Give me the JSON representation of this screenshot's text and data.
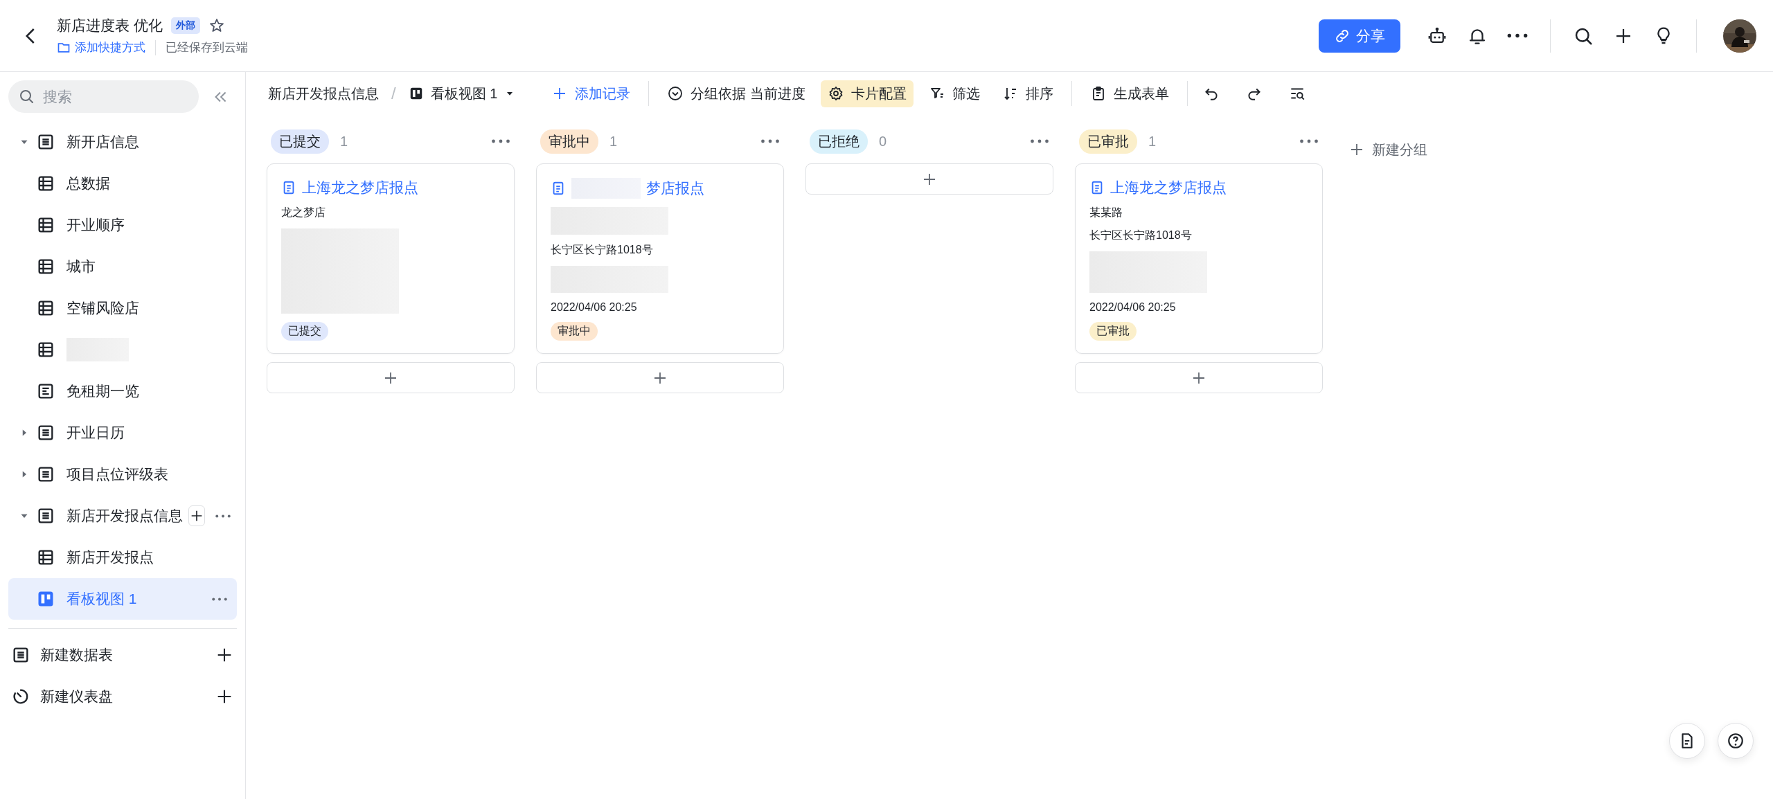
{
  "header": {
    "title": "新店进度表 优化",
    "badge": "外部",
    "starred": false,
    "shortcut": "添加快捷方式",
    "save_status": "已经保存到云端",
    "share": "分享"
  },
  "sidebar": {
    "search": {
      "placeholder": "搜索"
    },
    "tree": [
      {
        "label": "新开店信息",
        "kind": "group",
        "expanded": true,
        "selected": false,
        "children": [
          {
            "label": "总数据",
            "kind": "table",
            "selected": false
          },
          {
            "label": "开业顺序",
            "kind": "table",
            "selected": false
          },
          {
            "label": "城市",
            "kind": "table",
            "selected": false
          },
          {
            "label": "空铺风险店",
            "kind": "table",
            "selected": false
          },
          {
            "kind": "table",
            "redacted": true,
            "selected": false
          },
          {
            "label": "免租期一览",
            "kind": "form",
            "selected": false
          }
        ]
      },
      {
        "label": "开业日历",
        "kind": "group",
        "expanded": false,
        "selected": false
      },
      {
        "label": "项目点位评级表",
        "kind": "group",
        "expanded": false,
        "selected": false
      },
      {
        "label": "新店开发报点信息",
        "kind": "group",
        "expanded": true,
        "selected": false,
        "actions": true,
        "children": [
          {
            "label": "新店开发报点",
            "kind": "table",
            "selected": false
          },
          {
            "label": "看板视图 1",
            "kind": "kanban",
            "selected": true
          }
        ]
      }
    ],
    "footer": [
      {
        "label": "新建数据表",
        "kind": "table"
      },
      {
        "label": "新建仪表盘",
        "kind": "dashboard"
      }
    ]
  },
  "toolbar": {
    "breadcrumb": "新店开发报点信息",
    "separator": "/",
    "view": "看板视图 1",
    "add_record": "添加记录",
    "tools": [
      {
        "label": "分组依据 当前进度",
        "kind": "group",
        "selected": false
      },
      {
        "label": "卡片配置",
        "kind": "config",
        "selected": true
      },
      {
        "label": "筛选",
        "kind": "filter",
        "selected": false
      },
      {
        "label": "排序",
        "kind": "sort",
        "selected": false
      }
    ],
    "form": "生成表单"
  },
  "board": {
    "columns": [
      {
        "label": "已提交",
        "count": "1",
        "color": "#dfe7fc",
        "cards": [
          {
            "title": "上海龙之梦店报点",
            "fields": [
              {
                "kind": "text",
                "text": "龙之梦店"
              },
              {
                "kind": "redacted"
              },
              {
                "kind": "tag",
                "text": "已提交",
                "color": "#dfe7fc"
              }
            ]
          }
        ]
      },
      {
        "label": "审批中",
        "count": "1",
        "color": "#fde6cf",
        "cards": [
          {
            "title": "梦店报点",
            "title_redacted": true,
            "fields": [
              {
                "kind": "redacted"
              },
              {
                "kind": "text",
                "text": "长宁区长宁路1018号"
              },
              {
                "kind": "redacted"
              },
              {
                "kind": "text",
                "text": "2022/04/06  20:25"
              },
              {
                "kind": "tag",
                "text": "审批中",
                "color": "#fde6cf"
              }
            ]
          }
        ]
      },
      {
        "label": "已拒绝",
        "count": "0",
        "color": "#d9f1fb"
      },
      {
        "label": "已审批",
        "count": "1",
        "color": "#fbefca",
        "cards": [
          {
            "title": "上海龙之梦店报点",
            "fields": [
              {
                "kind": "text",
                "text": "某某路"
              },
              {
                "kind": "text",
                "text": "长宁区长宁路1018号"
              },
              {
                "kind": "redacted"
              },
              {
                "kind": "text",
                "text": "2022/04/06  20:25"
              },
              {
                "kind": "tag",
                "text": "已审批",
                "color": "#fbefca"
              }
            ]
          }
        ]
      }
    ],
    "new_group": "新建分组"
  }
}
